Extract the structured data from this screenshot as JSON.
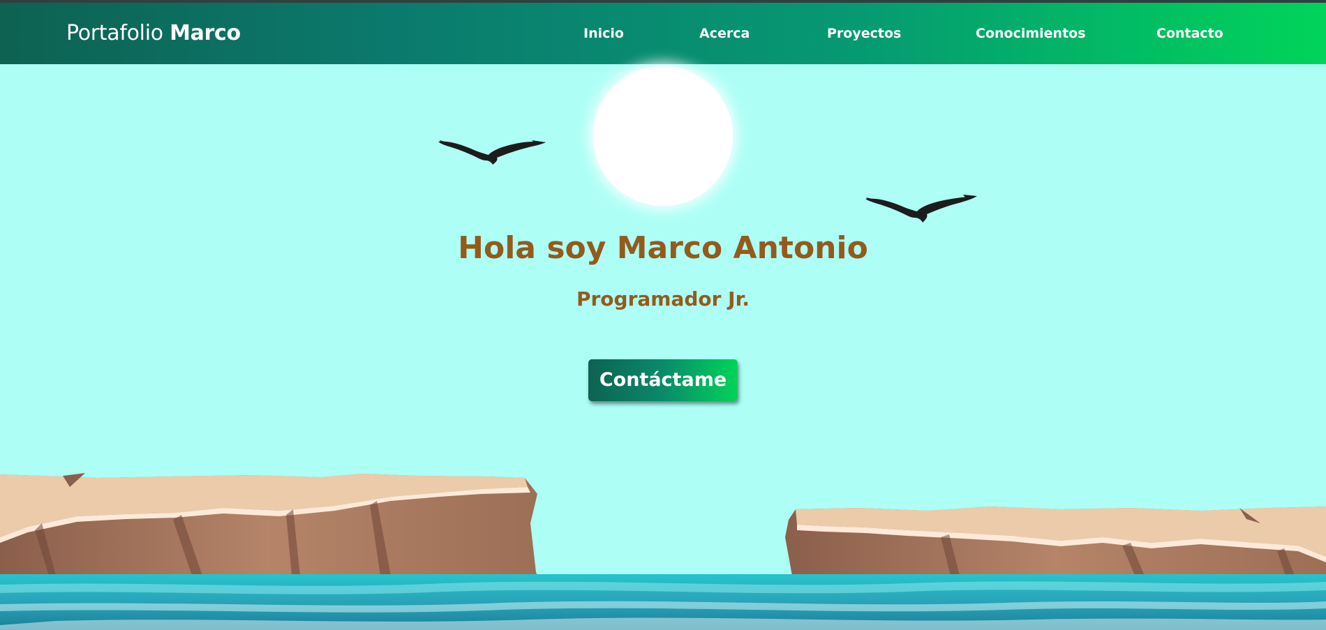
{
  "navbar": {
    "brand_light": "Portafolio",
    "brand_bold": "Marco",
    "links": [
      {
        "label": "Inicio"
      },
      {
        "label": "Acerca"
      },
      {
        "label": "Proyectos"
      },
      {
        "label": "Conocimientos"
      },
      {
        "label": "Contacto"
      }
    ]
  },
  "hero": {
    "title": "Hola soy Marco Antonio",
    "subtitle": "Programador Jr.",
    "cta_label": "Contáctame"
  },
  "colors": {
    "sky": "#adfff6",
    "accent_text": "#945a1c",
    "nav_gradient_start": "#0d6252",
    "nav_gradient_end": "#00d45a",
    "sea": "#2bb7c5",
    "cliff_top": "#eccbaa",
    "cliff_face": "#a77a60"
  },
  "icons": {
    "sun": "sun-illustration",
    "birds": "bird-icon",
    "cliffs": "cliff-illustration",
    "sea": "sea-illustration"
  }
}
